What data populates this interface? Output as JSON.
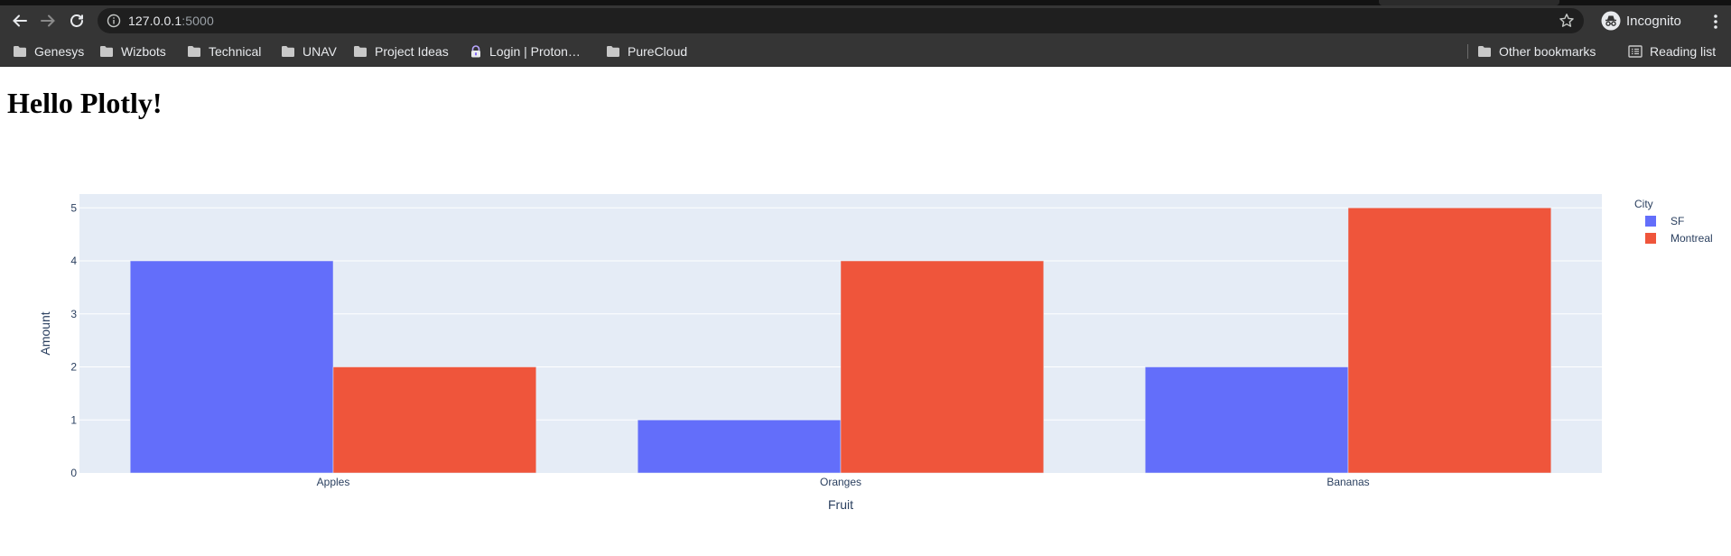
{
  "browser": {
    "url_host": "127.0.0.1",
    "url_port": ":5000",
    "profile_label": "Incognito",
    "icons": {
      "back": "arrow-left-icon",
      "forward": "arrow-right-icon",
      "reload": "reload-icon",
      "info": "info-icon",
      "bookmark_star": "star-icon",
      "incognito": "incognito-icon",
      "menu": "kebab-menu-icon"
    }
  },
  "bookmarks": {
    "items": [
      {
        "label": "Genesys",
        "icon": "folder-icon"
      },
      {
        "label": "Wizbots",
        "icon": "folder-icon"
      },
      {
        "label": "Technical",
        "icon": "folder-icon"
      },
      {
        "label": "UNAV",
        "icon": "folder-icon"
      },
      {
        "label": "Project Ideas",
        "icon": "folder-icon"
      },
      {
        "label": "Login | Proton…",
        "icon": "proton-lock-icon"
      },
      {
        "label": "PureCloud",
        "icon": "folder-icon"
      }
    ],
    "other_label": "Other bookmarks",
    "reading_list_label": "Reading list"
  },
  "page": {
    "title": "Hello Plotly!"
  },
  "chart_data": {
    "type": "bar",
    "barmode": "group",
    "categories": [
      "Apples",
      "Oranges",
      "Bananas"
    ],
    "series": [
      {
        "name": "SF",
        "values": [
          4,
          1,
          2
        ],
        "color": "#636efa"
      },
      {
        "name": "Montreal",
        "values": [
          2,
          4,
          5
        ],
        "color": "#ef553b"
      }
    ],
    "xlabel": "Fruit",
    "ylabel": "Amount",
    "legend_title": "City",
    "yticks": [
      0,
      1,
      2,
      3,
      4,
      5
    ],
    "ylim": [
      0,
      5.26
    ],
    "grid": true,
    "plot_background": "#e5ecf6",
    "legend_position": "right"
  }
}
